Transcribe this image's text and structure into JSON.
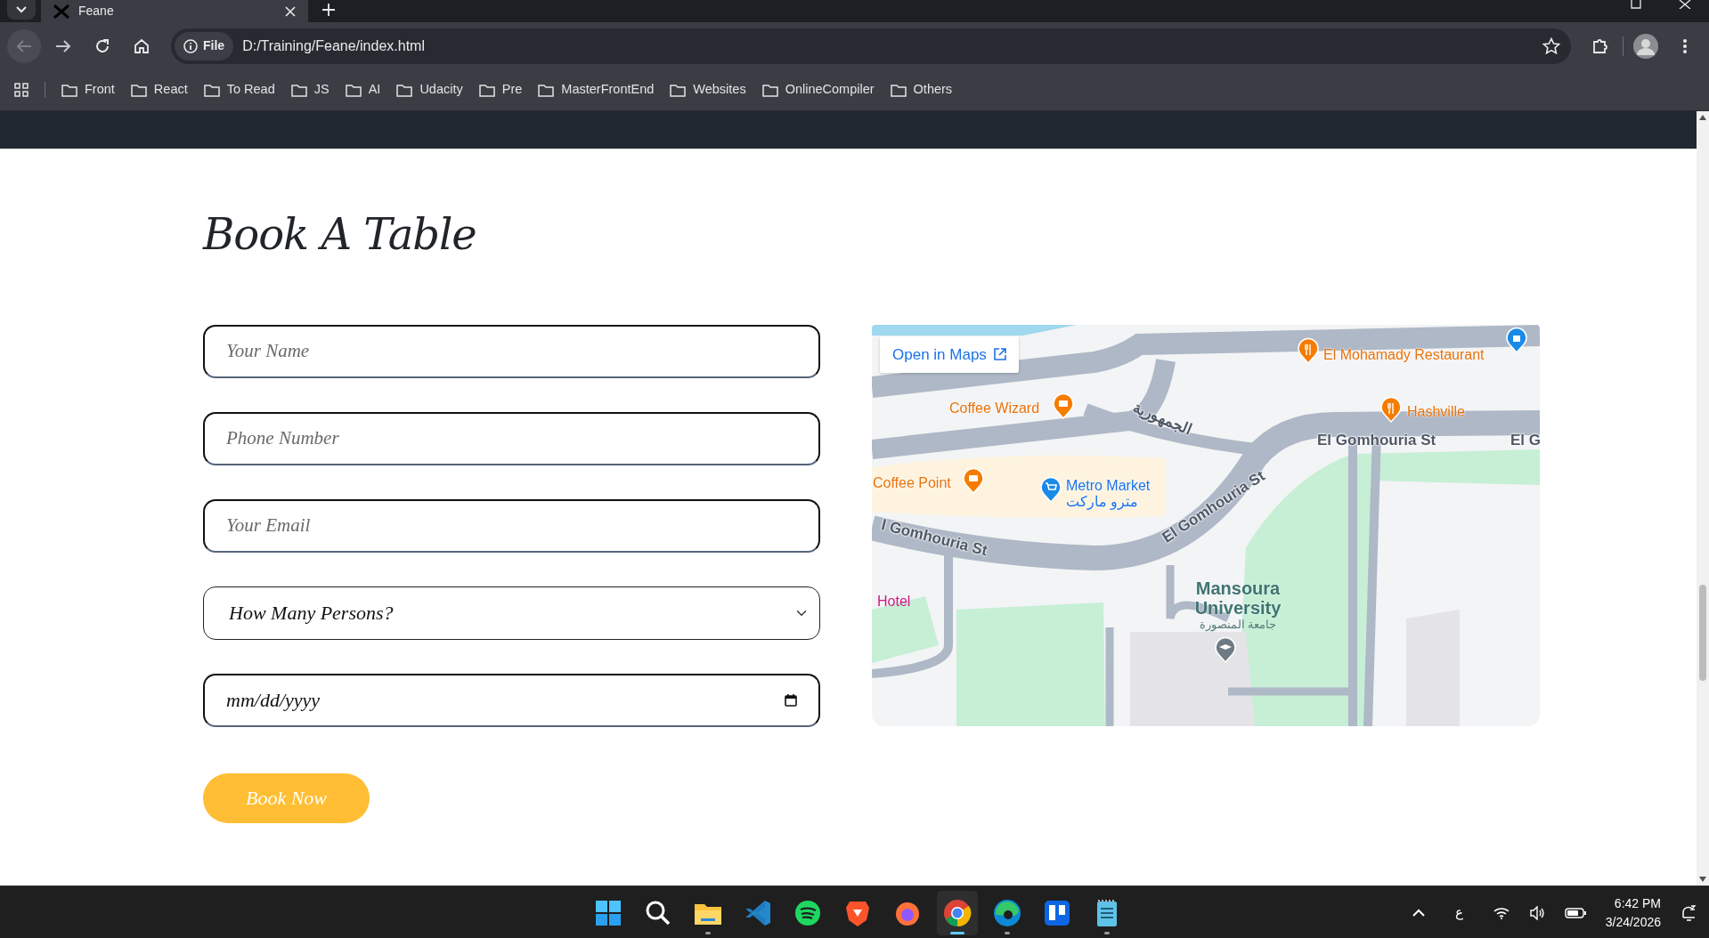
{
  "browser": {
    "tabs": [
      {
        "title": "Feane",
        "selected": true
      }
    ],
    "address": {
      "scheme": "File",
      "url": "D:/Training/Feane/index.html"
    },
    "back_disabled": true,
    "bookmarks": [
      "Front",
      "React",
      "To Read",
      "JS",
      "AI",
      "Udacity",
      "Pre",
      "MasterFrontEnd",
      "Websites",
      "OnlineCompiler",
      "Others"
    ]
  },
  "page": {
    "heading": "Book A Table",
    "fields": [
      {
        "kind": "text",
        "placeholder": "Your Name"
      },
      {
        "kind": "text",
        "placeholder": "Phone Number"
      },
      {
        "kind": "text",
        "placeholder": "Your Email"
      },
      {
        "kind": "select",
        "value": "How Many Persons?"
      },
      {
        "kind": "date",
        "value": "mm/dd/yyyy"
      }
    ],
    "submit": "Book Now",
    "map": {
      "open_link": "Open in Maps",
      "labels": [
        {
          "kind": "food",
          "text": "El Mohamady Restaurant"
        },
        {
          "kind": "food",
          "text": "Coffee Wizard"
        },
        {
          "kind": "street",
          "text": "الجمهورية"
        },
        {
          "kind": "food",
          "text": "Hashville"
        },
        {
          "kind": "street",
          "text": "El Gomhouria St"
        },
        {
          "kind": "street",
          "text": "El G"
        },
        {
          "kind": "food",
          "text": "Coffee Point"
        },
        {
          "kind": "shop",
          "text": "Metro Market"
        },
        {
          "kind": "shop",
          "text": "مترو ماركت"
        },
        {
          "kind": "street",
          "text": "l Gomhouria St"
        },
        {
          "kind": "street",
          "text": "El Gomhouria St"
        },
        {
          "kind": "hotel",
          "text": "Hotel"
        },
        {
          "kind": "landmark",
          "text": "Mansoura University"
        },
        {
          "kind": "landmark-sub",
          "text": "جامعة المنصورة"
        }
      ]
    }
  },
  "taskbar": {
    "apps": [
      {
        "kind": "start",
        "running": false,
        "selected": false
      },
      {
        "kind": "search",
        "running": false,
        "selected": false
      },
      {
        "kind": "files",
        "running": true,
        "selected": false
      },
      {
        "kind": "code",
        "running": false,
        "selected": false
      },
      {
        "kind": "music",
        "running": false,
        "selected": false
      },
      {
        "kind": "lion",
        "running": false,
        "selected": false
      },
      {
        "kind": "fox",
        "running": false,
        "selected": false
      },
      {
        "kind": "chrome",
        "running": true,
        "selected": true
      },
      {
        "kind": "edge",
        "running": true,
        "selected": false
      },
      {
        "kind": "board",
        "running": false,
        "selected": false
      },
      {
        "kind": "notepad",
        "running": true,
        "selected": false
      }
    ],
    "language": "ع",
    "time": "6:42 PM",
    "date": "3/24/2026"
  }
}
